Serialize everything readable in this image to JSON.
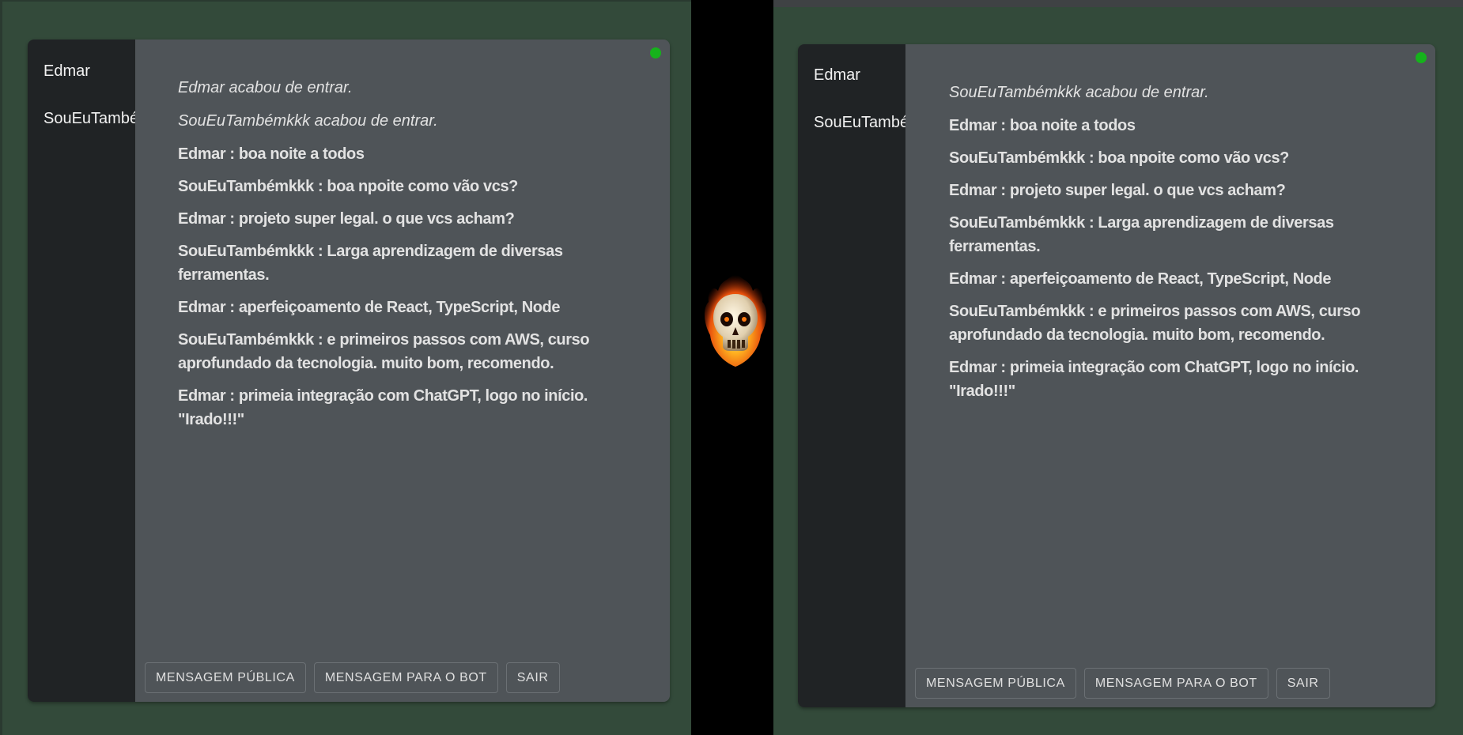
{
  "left_window": {
    "users": [
      "Edmar",
      "SouEuTambémkkk"
    ],
    "messages": [
      {
        "type": "join",
        "text": "Edmar acabou de entrar."
      },
      {
        "type": "join",
        "text": "SouEuTambémkkk acabou de entrar."
      },
      {
        "type": "msg",
        "text": "Edmar : boa noite a todos"
      },
      {
        "type": "msg",
        "text": "SouEuTambémkkk : boa npoite como vão vcs?"
      },
      {
        "type": "msg",
        "text": "Edmar : projeto super legal. o que vcs acham?"
      },
      {
        "type": "msg",
        "text": "SouEuTambémkkk : Larga aprendizagem de diversas ferramentas."
      },
      {
        "type": "msg",
        "text": "Edmar : aperfeiçoamento de React, TypeScript, Node"
      },
      {
        "type": "msg",
        "text": "SouEuTambémkkk : e primeiros passos com AWS, curso aprofundado da tecnologia. muito bom, recomendo."
      },
      {
        "type": "msg",
        "text": "Edmar : primeia integração com ChatGPT, logo no início. \"Irado!!!\""
      }
    ],
    "buttons": {
      "public": "MENSAGEM PÚBLICA",
      "bot": "MENSAGEM PARA O BOT",
      "exit": "SAIR"
    }
  },
  "right_window": {
    "users": [
      "Edmar",
      "SouEuTambémkkk"
    ],
    "messages": [
      {
        "type": "join",
        "text": "SouEuTambémkkk acabou de entrar."
      },
      {
        "type": "msg",
        "text": "Edmar : boa noite a todos"
      },
      {
        "type": "msg",
        "text": "SouEuTambémkkk : boa npoite como vão vcs?"
      },
      {
        "type": "msg",
        "text": "Edmar : projeto super legal. o que vcs acham?"
      },
      {
        "type": "msg",
        "text": "SouEuTambémkkk : Larga aprendizagem de diversas ferramentas."
      },
      {
        "type": "msg",
        "text": "Edmar : aperfeiçoamento de React, TypeScript, Node"
      },
      {
        "type": "msg",
        "text": "SouEuTambémkkk : e primeiros passos com AWS, curso aprofundado da tecnologia. muito bom, recomendo."
      },
      {
        "type": "msg",
        "text": "Edmar : primeia integração com ChatGPT, logo no início. \"Irado!!!\""
      }
    ],
    "buttons": {
      "public": "MENSAGEM PÚBLICA",
      "bot": "MENSAGEM PARA O BOT",
      "exit": "SAIR"
    }
  },
  "colors": {
    "page_bg": "#334a3a",
    "sidebar_bg": "#202325",
    "chat_bg": "#4f5458",
    "text": "#e2e2e2",
    "online_status": "#16b21c"
  },
  "icons": {
    "online": "online-status-icon",
    "divider": "flaming-skull-icon"
  }
}
